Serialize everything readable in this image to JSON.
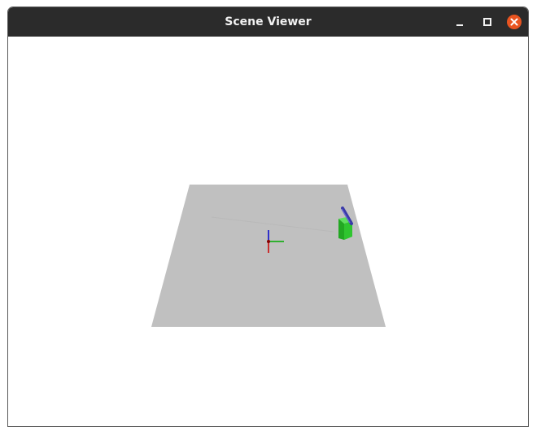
{
  "window": {
    "title": "Scene Viewer"
  },
  "titlebar_buttons": [
    {
      "name": "minimize",
      "icon": "minimize-icon"
    },
    {
      "name": "maximize",
      "icon": "maximize-icon"
    },
    {
      "name": "close",
      "icon": "close-icon"
    }
  ],
  "colors": {
    "titlebar": "#2b2b2b",
    "close_button": "#e95420",
    "ground_plane": "#c0c0c0",
    "object_box": "#2fc52f",
    "object_rod": "#3a3aa8",
    "axis_x": "#cc0000",
    "axis_y": "#00aa00",
    "axis_z": "#0000cc"
  },
  "scene": {
    "objects": [
      "ground-plane",
      "world-origin-axes",
      "green-box",
      "blue-rod"
    ]
  }
}
